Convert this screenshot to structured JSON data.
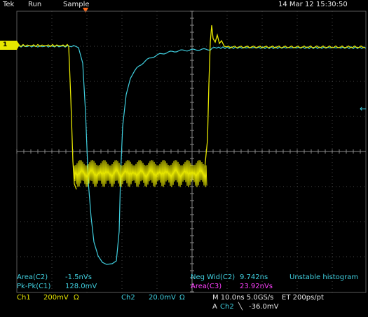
{
  "header": {
    "brand": "Tek",
    "mode": "Run",
    "acquisition": "Sample",
    "datetime": "14 Mar 12 15:30:50"
  },
  "markers": {
    "ch1_label": "1",
    "trigger_level_glyph": "←"
  },
  "measurements": {
    "area_c2_label": "Area(C2)",
    "area_c2_value": "-1.5nVs",
    "pkpk_c1_label": "Pk-Pk(C1)",
    "pkpk_c1_value": "128.0mV",
    "negwid_c2_label": "Neg Wid(C2)",
    "negwid_c2_value": "9.742ns",
    "histogram_status": "Unstable histogram",
    "area_c3_label": "Area(C3)",
    "area_c3_value": "23.92nVs"
  },
  "channels": {
    "ch1_label": "Ch1",
    "ch1_scale": "200mV",
    "ch1_impedance": "Ω",
    "ch2_label": "Ch2",
    "ch2_scale": "20.0mV",
    "ch2_impedance": "Ω"
  },
  "timebase": {
    "horizontal": "M 10.0ns 5.0GS/s",
    "record": "ET 200ps/pt",
    "trigger_prefix": "A",
    "trigger_source": "Ch2",
    "trigger_slope_glyph": "╲",
    "trigger_level": "-36.0mV"
  },
  "colors": {
    "ch1": "#e6e600",
    "ch2": "#40d0e0",
    "math": "#ff40ff",
    "trigger": "#ff6a1a"
  }
}
